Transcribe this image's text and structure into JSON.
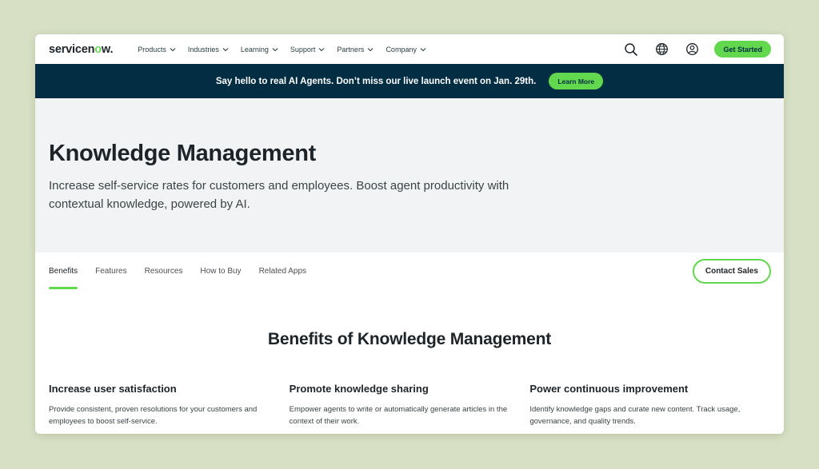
{
  "header": {
    "logo_main": "servicen",
    "logo_o": "o",
    "logo_end": "w.",
    "menu": [
      {
        "label": "Products"
      },
      {
        "label": "Industries"
      },
      {
        "label": "Learning"
      },
      {
        "label": "Support"
      },
      {
        "label": "Partners"
      },
      {
        "label": "Company"
      }
    ],
    "icons": [
      "search-icon",
      "globe-icon",
      "user-icon"
    ],
    "cta_label": "Get Started"
  },
  "banner": {
    "text": "Say hello to real AI Agents. Don’t miss our live launch event on Jan. 29th.",
    "button_label": "Learn More"
  },
  "hero": {
    "title": "Knowledge Management",
    "subtitle": "Increase self-service rates for customers and employees. Boost agent productivity with contextual knowledge, powered by AI."
  },
  "tabs": {
    "items": [
      {
        "label": "Benefits",
        "active": true
      },
      {
        "label": "Features"
      },
      {
        "label": "Resources"
      },
      {
        "label": "How to Buy"
      },
      {
        "label": "Related Apps"
      }
    ],
    "contact_label": "Contact Sales"
  },
  "benefits": {
    "title": "Benefits of Knowledge Management",
    "items": [
      {
        "title": "Increase user satisfaction",
        "text": "Provide consistent, proven resolutions for your customers and employees to boost self-service."
      },
      {
        "title": "Promote knowledge sharing",
        "text": "Empower agents to write or automatically generate articles in the context of their work."
      },
      {
        "title": "Power continuous improvement",
        "text": "Identify knowledge gaps and curate new content. Track usage, governance, and quality trends."
      }
    ]
  },
  "colors": {
    "accent": "#62d84e",
    "banner_bg": "#032d42",
    "page_bg": "#d7e0c4",
    "hero_bg": "#f2f3f5"
  }
}
